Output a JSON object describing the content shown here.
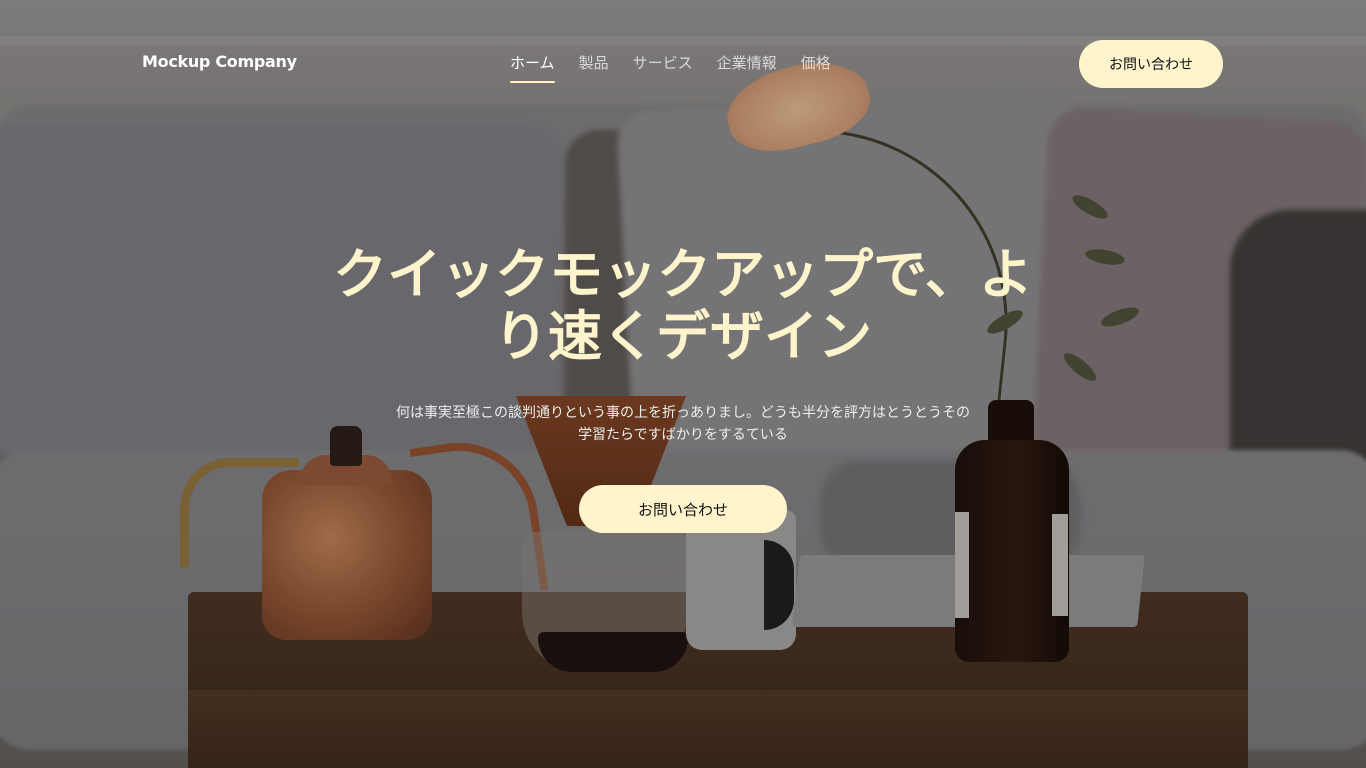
{
  "header": {
    "brand": "Mockup Company",
    "nav": [
      {
        "label": "ホーム",
        "active": true
      },
      {
        "label": "製品",
        "active": false
      },
      {
        "label": "サービス",
        "active": false
      },
      {
        "label": "企業情報",
        "active": false
      },
      {
        "label": "価格",
        "active": false
      }
    ],
    "cta_label": "お問い合わせ"
  },
  "hero": {
    "title": "クイックモックアップで、より速くデザイン",
    "subtitle": "何は事実至極この談判通りという事の上を折っありまし。どうも半分を評方はとうとうその学習たらですばかりをするている",
    "cta_label": "お問い合わせ",
    "background_image": "living-room-coffee-table-photo"
  },
  "colors": {
    "accent": "#fff4cc",
    "nav_text": "#ffffff",
    "subtitle_text": "#eeeeee"
  }
}
